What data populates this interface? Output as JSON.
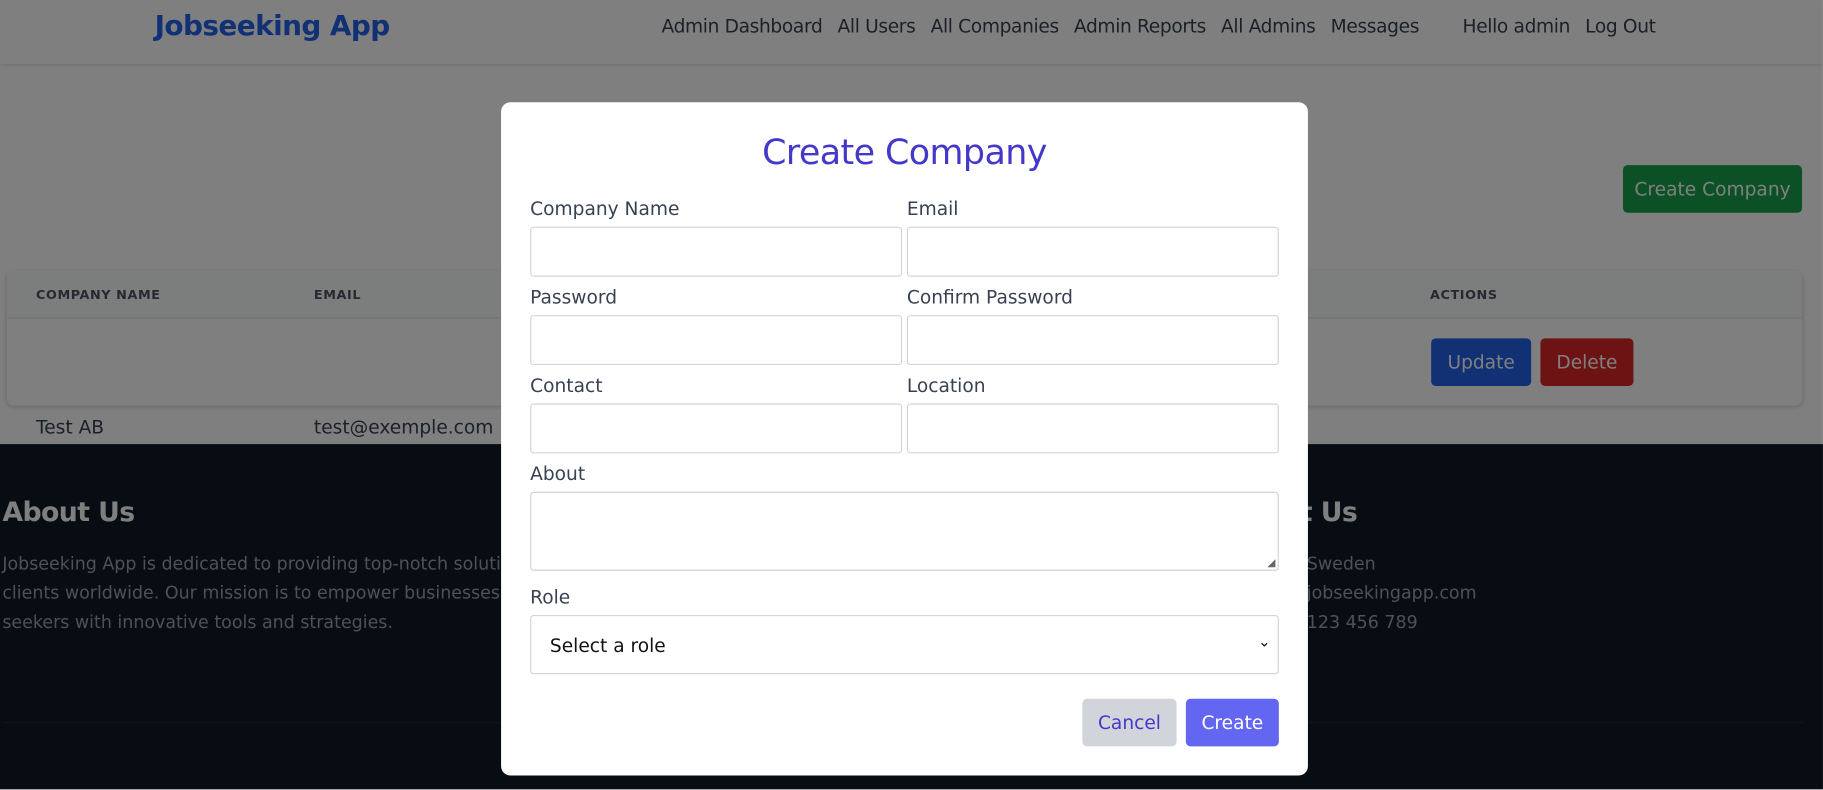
{
  "header": {
    "logo": "Jobseeking App",
    "nav": [
      "Admin Dashboard",
      "All Users",
      "All Companies",
      "Admin Reports",
      "All Admins",
      "Messages"
    ],
    "greeting": "Hello admin",
    "logout": "Log Out"
  },
  "main": {
    "create_button": "Create Company",
    "table": {
      "headers": [
        "COMPANY NAME",
        "EMAIL",
        "ACTIONS"
      ],
      "rows": [
        {
          "name": "Test AB",
          "email": "test@exemple.com",
          "update": "Update",
          "delete": "Delete"
        }
      ]
    }
  },
  "footer": {
    "about_title": "About Us",
    "about_lines": [
      "Jobseeking App is dedicated to providing top-notch solutio",
      "clients worldwide. Our mission is to empower businesses an",
      "seekers with innovative tools and strategies."
    ],
    "contact_title": "t Us",
    "contact_lines": [
      "Sweden",
      "jobseekingapp.com",
      "123 456 789"
    ]
  },
  "modal": {
    "title": "Create Company",
    "labels": {
      "company_name": "Company Name",
      "email": "Email",
      "password": "Password",
      "confirm_password": "Confirm Password",
      "contact": "Contact",
      "location": "Location",
      "about": "About",
      "role": "Role"
    },
    "role_select": "Select a role",
    "cancel": "Cancel",
    "create": "Create"
  },
  "colors": {
    "brand": "#2563eb",
    "modal_title": "#4338ca",
    "create": "#6366f1",
    "cancel_bg": "#d1d5db",
    "green": "#16a34a",
    "update": "#2563eb",
    "delete": "#dc2626",
    "footer_bg": "#111827"
  }
}
